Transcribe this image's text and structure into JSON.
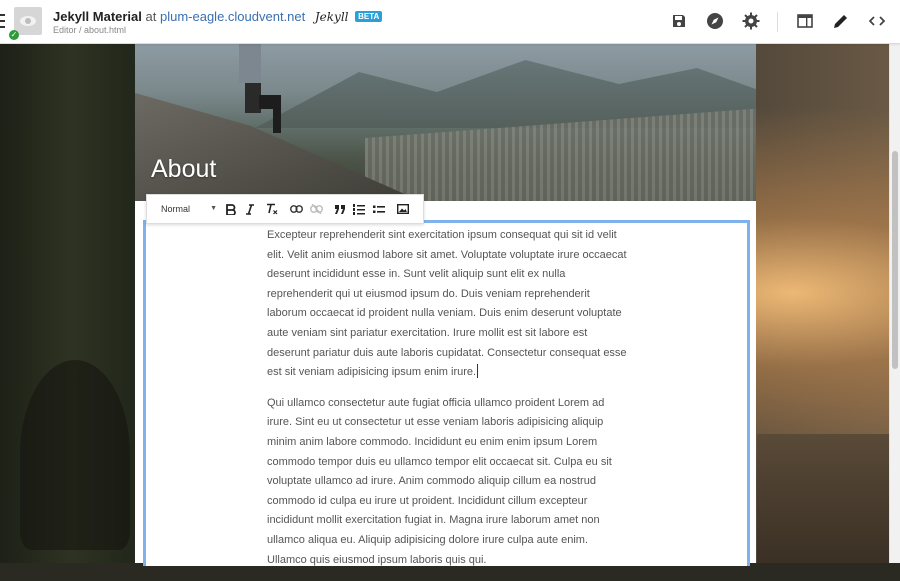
{
  "header": {
    "site_title": "Jekyll Material",
    "at_label": "at",
    "site_domain": "plum-eagle.cloudvent.net",
    "jekyll_logo": "Jekyll",
    "beta_badge": "BETA",
    "breadcrumb": "Editor / about.html",
    "icons": [
      "menu-icon",
      "save-icon",
      "compass-icon",
      "settings-icon",
      "layout-icon",
      "edit-icon",
      "code-icon"
    ]
  },
  "page": {
    "hero_title": "About"
  },
  "editor_toolbar": {
    "format_value": "Normal",
    "buttons": [
      "bold",
      "italic",
      "clear-formatting",
      "link",
      "unlink",
      "blockquote",
      "numbered-list",
      "bulleted-list",
      "image"
    ]
  },
  "content": {
    "paragraphs": [
      "Excepteur reprehenderit sint exercitation ipsum consequat qui sit id velit elit. Velit anim eiusmod labore sit amet. Voluptate voluptate irure occaecat deserunt incididunt esse in. Sunt velit aliquip sunt elit ex nulla reprehenderit qui ut eiusmod ipsum do. Duis veniam reprehenderit laborum occaecat id proident nulla veniam. Duis enim deserunt voluptate aute veniam sint pariatur exercitation. Irure mollit est sit labore est deserunt pariatur duis aute laboris cupidatat. Consectetur consequat esse est sit veniam adipisicing ipsum enim irure.",
      "Qui ullamco consectetur aute fugiat officia ullamco proident Lorem ad irure. Sint eu ut consectetur ut esse veniam laboris adipisicing aliquip minim anim labore commodo. Incididunt eu enim enim ipsum Lorem commodo tempor duis eu ullamco tempor elit occaecat sit. Culpa eu sit voluptate ullamco ad irure. Anim commodo aliquip cillum ea nostrud commodo id culpa eu irure ut proident. Incididunt cillum excepteur incididunt mollit exercitation fugiat in. Magna irure laborum amet non ullamco aliqua eu. Aliquip adipisicing dolore irure culpa aute enim. Ullamco quis eiusmod ipsum laboris quis qui."
    ]
  },
  "colors": {
    "accent_blue": "#7fb2ea",
    "link_blue": "#3a6fb0",
    "beta_badge": "#2aa0d8",
    "status_green": "#2e9a3a"
  }
}
